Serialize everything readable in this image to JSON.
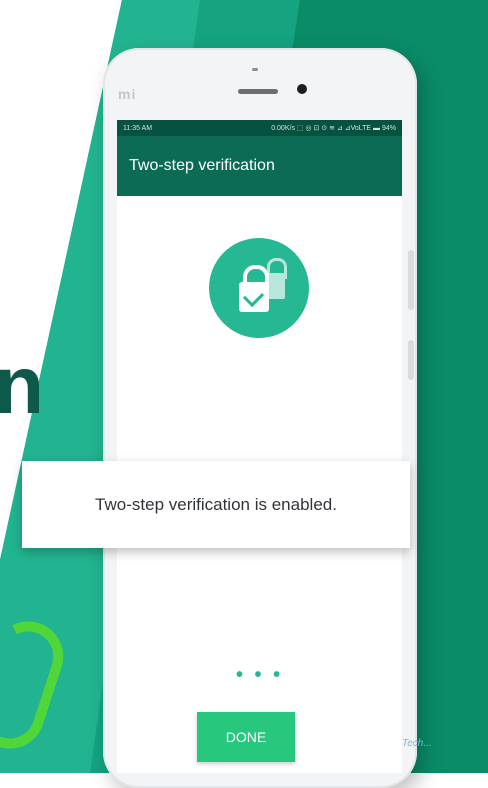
{
  "background": {
    "colors": {
      "dark": "#0a8c68",
      "mid": "#16a583",
      "light": "#26b893"
    },
    "partial_char": "n"
  },
  "statusbar": {
    "time": "11:35 AM",
    "indicators": "0.00K/s ⬚ ◎ ⊡ ⊙ ≋ ⊿ ⊿VoLTE ▬ 94%"
  },
  "appbar": {
    "title": "Two-step verification"
  },
  "main": {
    "icon": "lock-check-icon",
    "dots": "• • •",
    "done_label": "DONE"
  },
  "banner": {
    "message": "Two-step verification is enabled."
  },
  "phone": {
    "logo": "mi"
  },
  "watermark": {
    "text": "Tech..."
  }
}
